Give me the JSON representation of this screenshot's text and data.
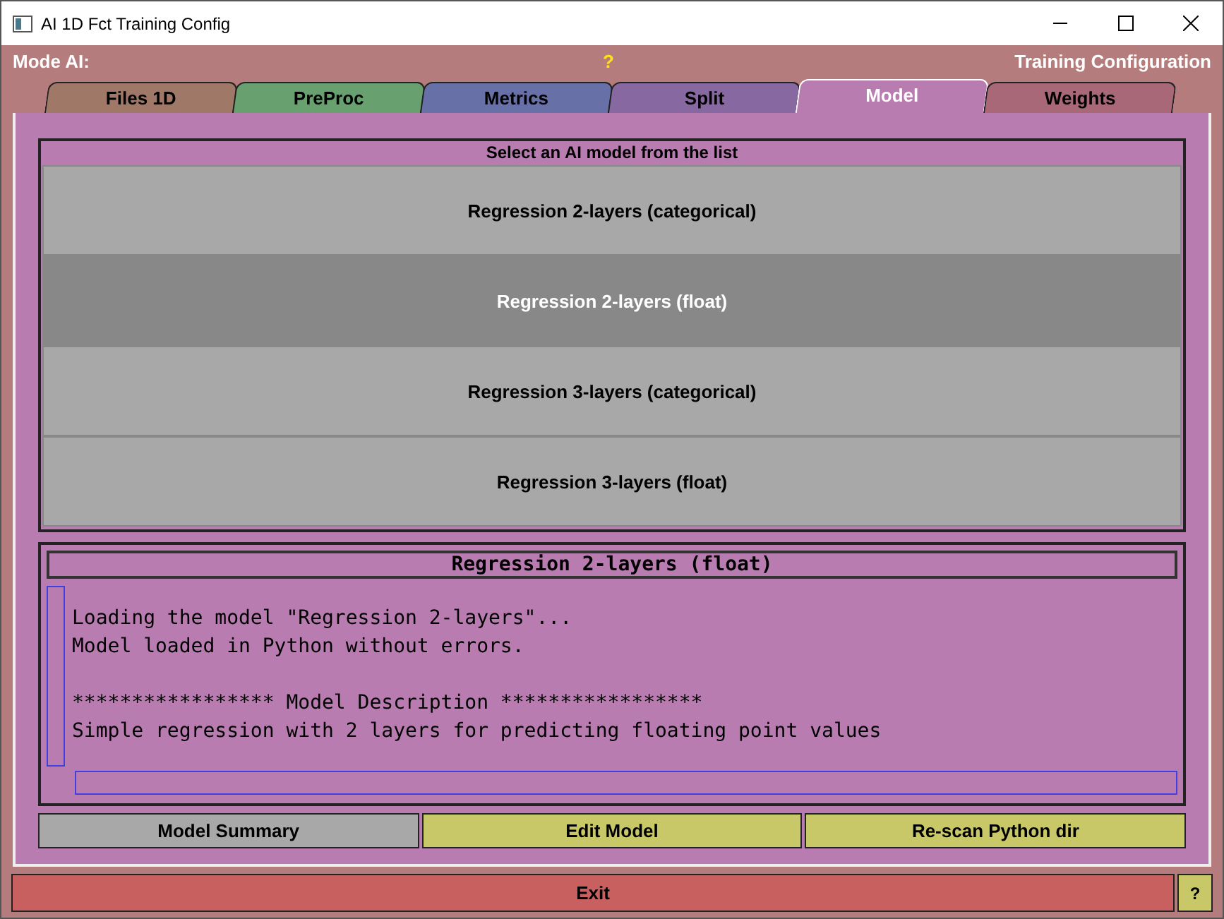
{
  "window": {
    "title": "AI 1D Fct Training Config"
  },
  "header": {
    "left": "Mode AI:",
    "center": "?",
    "right": "Training Configuration"
  },
  "tabs": [
    {
      "label": "Files 1D",
      "selected": false,
      "color": "#a07868"
    },
    {
      "label": "PreProc",
      "selected": false,
      "color": "#68a070"
    },
    {
      "label": "Metrics",
      "selected": false,
      "color": "#6870a8"
    },
    {
      "label": "Split",
      "selected": false,
      "color": "#8868a0"
    },
    {
      "label": "Model",
      "selected": true,
      "color": "#b87cb0"
    },
    {
      "label": "Weights",
      "selected": false,
      "color": "#a86878"
    }
  ],
  "model_list": {
    "title": "Select an AI model from the list",
    "items": [
      {
        "label": "Regression 2-layers (categorical)",
        "selected": false
      },
      {
        "label": "Regression 2-layers (float)",
        "selected": true
      },
      {
        "label": "Regression 3-layers (categorical)",
        "selected": false
      },
      {
        "label": "Regression 3-layers (float)",
        "selected": false
      }
    ]
  },
  "details": {
    "title": "Regression 2-layers (float)",
    "log": "Loading the model \"Regression 2-layers\"...\nModel loaded in Python without errors.\n\n***************** Model Description *****************\nSimple regression with 2 layers for predicting floating point values"
  },
  "buttons": [
    {
      "label": "Model Summary",
      "color": "#a8a8a8"
    },
    {
      "label": "Edit Model",
      "color": "#c8c868"
    },
    {
      "label": "Re-scan Python dir",
      "color": "#c8c868"
    }
  ],
  "footer": {
    "exit": "Exit",
    "help": "?"
  }
}
